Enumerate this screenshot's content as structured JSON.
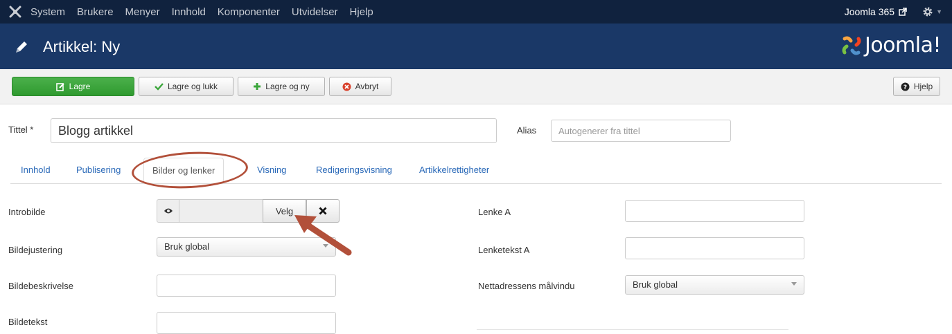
{
  "navbar": {
    "menu": [
      "System",
      "Brukere",
      "Menyer",
      "Innhold",
      "Komponenter",
      "Utvidelser",
      "Hjelp"
    ],
    "site_name": "Joomla 365"
  },
  "header": {
    "title": "Artikkel: Ny",
    "brand": "Joomla!"
  },
  "toolbar": {
    "save_label": "Lagre",
    "save_close_label": "Lagre og lukk",
    "save_new_label": "Lagre og ny",
    "cancel_label": "Avbryt",
    "help_label": "Hjelp"
  },
  "title_row": {
    "title_label": "Tittel *",
    "title_value": "Blogg artikkel",
    "alias_label": "Alias",
    "alias_placeholder": "Autogenerer fra tittel"
  },
  "tabs": [
    {
      "label": "Innhold"
    },
    {
      "label": "Publisering"
    },
    {
      "label": "Bilder og lenker",
      "active": true
    },
    {
      "label": "Visning"
    },
    {
      "label": "Redigeringsvisning"
    },
    {
      "label": "Artikkelrettigheter"
    }
  ],
  "form_left": {
    "intro_image_label": "Introbilde",
    "select_button_label": "Velg",
    "image_float_label": "Bildejustering",
    "image_float_value": "Bruk global",
    "image_alt_label": "Bildebeskrivelse",
    "image_caption_label": "Bildetekst"
  },
  "form_right": {
    "link_a_label": "Lenke A",
    "link_a_text_label": "Lenketekst A",
    "url_target_label": "Nettadressens målvindu",
    "url_target_value": "Bruk global"
  },
  "colors": {
    "navbar_bg": "#10223e",
    "header_bg": "#1a3867",
    "save_green": "#3ba63b",
    "link_blue": "#2a69b8",
    "annotation": "#b2503a"
  }
}
